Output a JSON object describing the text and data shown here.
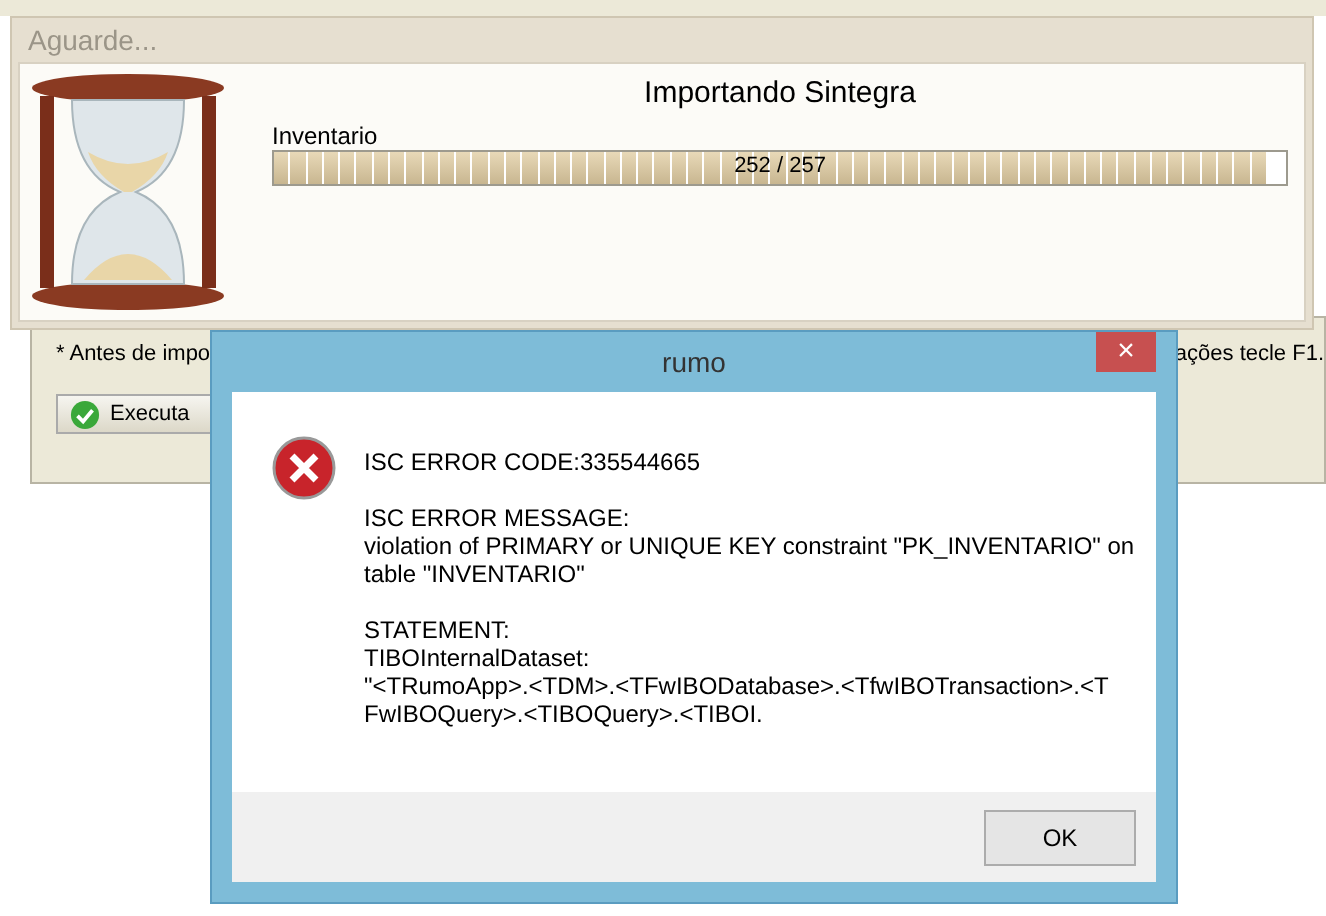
{
  "background_form": {
    "note_left": "* Antes de impo",
    "note_right": "ações tecle F1.",
    "execute_button": "Executa"
  },
  "progress_dialog": {
    "title": "Aguarde...",
    "heading": "Importando Sintegra",
    "task": "Inventario",
    "level": 0.98,
    "reading": "252 / 257"
  },
  "error_dialog": {
    "title": "rumo",
    "close": "×",
    "paragraphs": [
      [
        "ISC ERROR CODE:335544665"
      ],
      [
        "ISC ERROR MESSAGE:",
        "violation of PRIMARY or UNIQUE KEY constraint \"PK_INVENTARIO\" on",
        "table \"INVENTARIO\""
      ],
      [
        "STATEMENT:",
        "TIBOInternalDataset:",
        "\"<TRumoApp>.<TDM>.<TFwIBODatabase>.<TfwIBOTransaction>.<T",
        "FwIBOQuery>.<TIBOQuery>.<TIBOI."
      ]
    ],
    "ok": "OK"
  }
}
